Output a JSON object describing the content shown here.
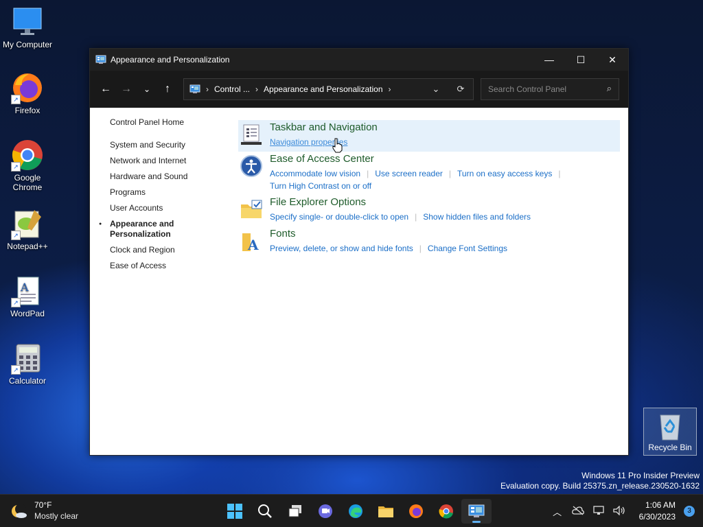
{
  "desktop": {
    "icons": [
      {
        "label": "My Computer"
      },
      {
        "label": "Firefox"
      },
      {
        "label": "Google Chrome"
      },
      {
        "label": "Notepad++"
      },
      {
        "label": "WordPad"
      },
      {
        "label": "Calculator"
      }
    ],
    "recycle_bin": "Recycle Bin",
    "watermark": {
      "line1": "Windows 11 Pro Insider Preview",
      "line2": "Evaluation copy. Build 25375.zn_release.230520-1632"
    }
  },
  "window": {
    "title": "Appearance and Personalization",
    "address": {
      "crumb1": "Control ...",
      "crumb2": "Appearance and Personalization"
    },
    "search": {
      "placeholder": "Search Control Panel"
    },
    "left_nav": {
      "home": "Control Panel Home",
      "items": [
        "System and Security",
        "Network and Internet",
        "Hardware and Sound",
        "Programs",
        "User Accounts"
      ],
      "current": "Appearance and Personalization",
      "items_after": [
        "Clock and Region",
        "Ease of Access"
      ]
    },
    "categories": [
      {
        "title": "Taskbar and Navigation",
        "links": [
          "Navigation properties"
        ]
      },
      {
        "title": "Ease of Access Center",
        "links": [
          "Accommodate low vision",
          "Use screen reader",
          "Turn on easy access keys",
          "Turn High Contrast on or off"
        ]
      },
      {
        "title": "File Explorer Options",
        "links": [
          "Specify single- or double-click to open",
          "Show hidden files and folders"
        ]
      },
      {
        "title": "Fonts",
        "links": [
          "Preview, delete, or show and hide fonts",
          "Change Font Settings"
        ]
      }
    ]
  },
  "taskbar": {
    "weather": {
      "temp": "70°F",
      "condition": "Mostly clear"
    },
    "clock": {
      "time": "1:06 AM",
      "date": "6/30/2023"
    },
    "notification_count": "3"
  },
  "colors": {
    "accent": "#1a6ec7",
    "category_title": "#1e5b2a",
    "highlight": "#e5f1fb"
  }
}
